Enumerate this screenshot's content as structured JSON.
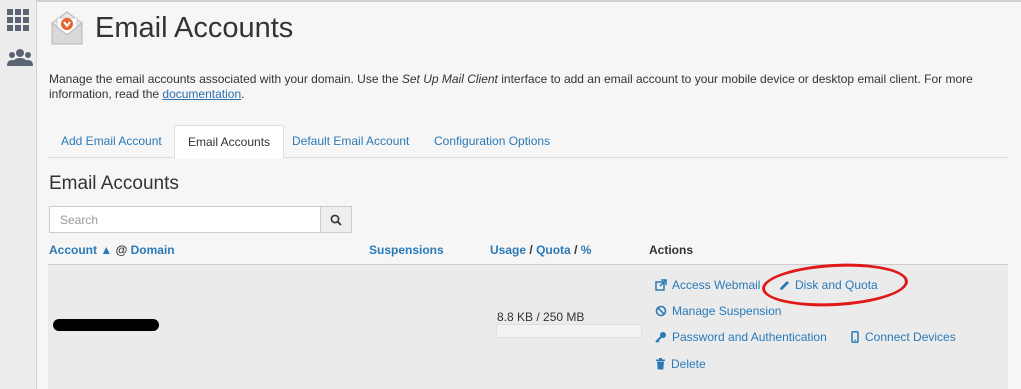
{
  "sidebar": {
    "icons": [
      "apps-grid-icon",
      "users-icon"
    ]
  },
  "header": {
    "title": "Email Accounts",
    "icon": "email-accounts-icon"
  },
  "description": {
    "part1": "Manage the email accounts associated with your domain. Use the ",
    "italic": "Set Up Mail Client",
    "part2": " interface to add an email account to your mobile device or desktop email client. For more information, read the ",
    "link": "documentation",
    "part3": "."
  },
  "tabs": [
    {
      "label": "Add Email Account",
      "active": false
    },
    {
      "label": "Email Accounts",
      "active": true
    },
    {
      "label": "Default Email Account",
      "active": false
    },
    {
      "label": "Configuration Options",
      "active": false
    }
  ],
  "section": {
    "title": "Email Accounts"
  },
  "search": {
    "placeholder": "Search",
    "value": ""
  },
  "table": {
    "headers": {
      "account": "Account",
      "sort_arrow": "▲",
      "at": "@",
      "domain": "Domain",
      "suspensions": "Suspensions",
      "usage": "Usage",
      "sep1": "/",
      "quota": "Quota",
      "sep2": "/",
      "percent": "%",
      "actions": "Actions"
    },
    "rows": [
      {
        "account": "",
        "usage_text": "8.8 KB / 250 MB",
        "usage_fraction": 0.0,
        "actions": {
          "access_webmail": "Access Webmail",
          "disk_and_quota": "Disk and Quota",
          "manage_suspension": "Manage Suspension",
          "password_and_authentication": "Password and Authentication",
          "connect_devices": "Connect Devices",
          "delete": "Delete"
        }
      }
    ]
  },
  "colors": {
    "link": "#2a7ab8",
    "annotation": "#e01818",
    "accent_icon": "#e8642a"
  }
}
